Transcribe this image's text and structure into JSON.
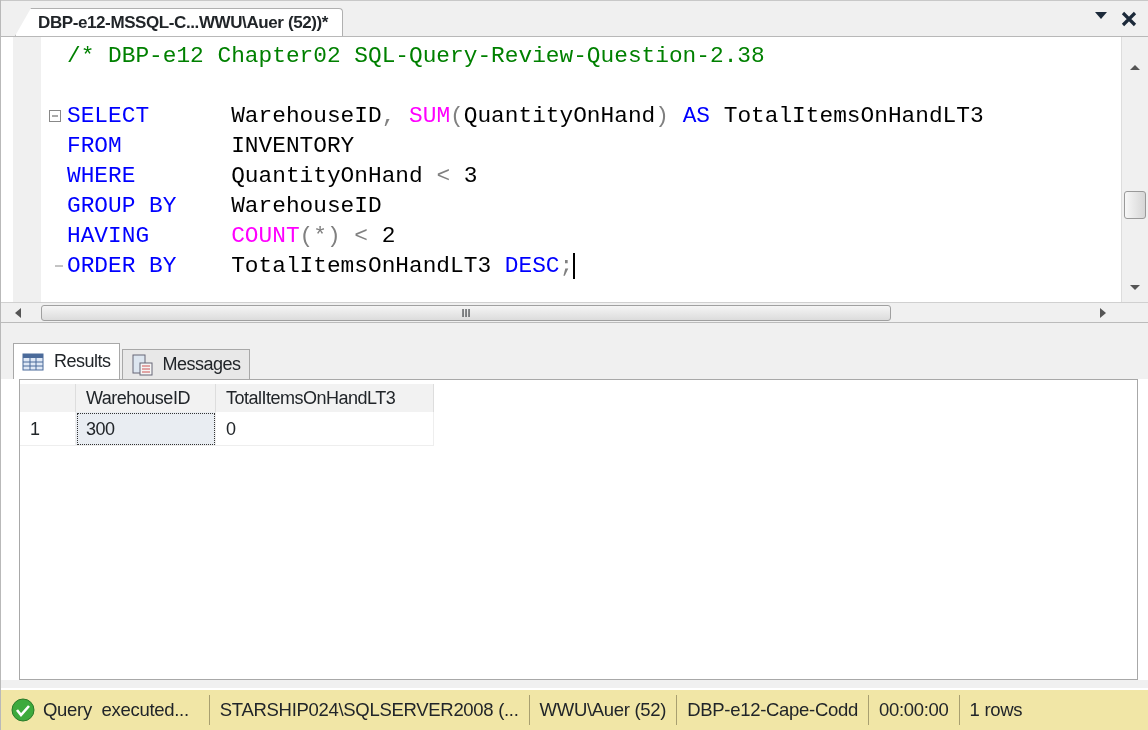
{
  "document_tab": {
    "title": "DBP-e12-MSSQL-C...WWU\\Auer (52))*",
    "selected": true
  },
  "editor": {
    "lines": [
      {
        "tokens": [
          {
            "kind": "comment",
            "text": "/* DBP-e12 Chapter02 SQL-Query-Review-Question-2.38"
          }
        ]
      },
      {
        "blank_line_before": true,
        "fold_start": true,
        "clause": "SELECT",
        "tokens": [
          {
            "kind": "plain",
            "text": "WarehouseID"
          },
          {
            "kind": "operator",
            "text": ", "
          },
          {
            "kind": "function",
            "text": "SUM"
          },
          {
            "kind": "operator",
            "text": "("
          },
          {
            "kind": "plain",
            "text": "QuantityOnHand"
          },
          {
            "kind": "operator",
            "text": ") "
          },
          {
            "kind": "keyword",
            "text": "AS"
          },
          {
            "kind": "plain",
            "text": " TotalItemsOnHandLT3"
          }
        ]
      },
      {
        "clause": "FROM",
        "tokens": [
          {
            "kind": "plain",
            "text": "INVENTORY"
          }
        ]
      },
      {
        "clause": "WHERE",
        "tokens": [
          {
            "kind": "plain",
            "text": "QuantityOnHand "
          },
          {
            "kind": "operator",
            "text": "<"
          },
          {
            "kind": "plain",
            "text": " 3"
          }
        ]
      },
      {
        "clause": "GROUP BY",
        "tokens": [
          {
            "kind": "plain",
            "text": "WarehouseID"
          }
        ]
      },
      {
        "clause": "HAVING",
        "tokens": [
          {
            "kind": "function",
            "text": "COUNT"
          },
          {
            "kind": "operator",
            "text": "(*) <"
          },
          {
            "kind": "plain",
            "text": " 2"
          }
        ]
      },
      {
        "fold_end": true,
        "cursor": true,
        "clause": "ORDER BY",
        "tokens": [
          {
            "kind": "plain",
            "text": "TotalItemsOnHandLT3 "
          },
          {
            "kind": "keyword",
            "text": "DESC"
          },
          {
            "kind": "operator",
            "text": ";"
          }
        ]
      }
    ]
  },
  "horizontal_scrollbar_grip": "III",
  "result_tabs": [
    {
      "label": "Results",
      "kind": "grid",
      "selected": true
    },
    {
      "label": "Messages",
      "kind": "messages",
      "selected": false
    }
  ],
  "results": {
    "columns": [
      "WarehouseID",
      "TotalItemsOnHandLT3"
    ],
    "rows": [
      {
        "number": "1",
        "cells": [
          {
            "text": "300",
            "focused": true
          },
          {
            "text": "0",
            "focused": false
          }
        ]
      }
    ]
  },
  "status_bar": {
    "status": {
      "text": "Query  executed...",
      "kind": "success"
    },
    "segments": [
      "STARSHIP024\\SQLSERVER2008 (...",
      "WWU\\Auer (52)",
      "DBP-e12-Cape-Codd",
      "00:00:00",
      "1 rows"
    ]
  }
}
